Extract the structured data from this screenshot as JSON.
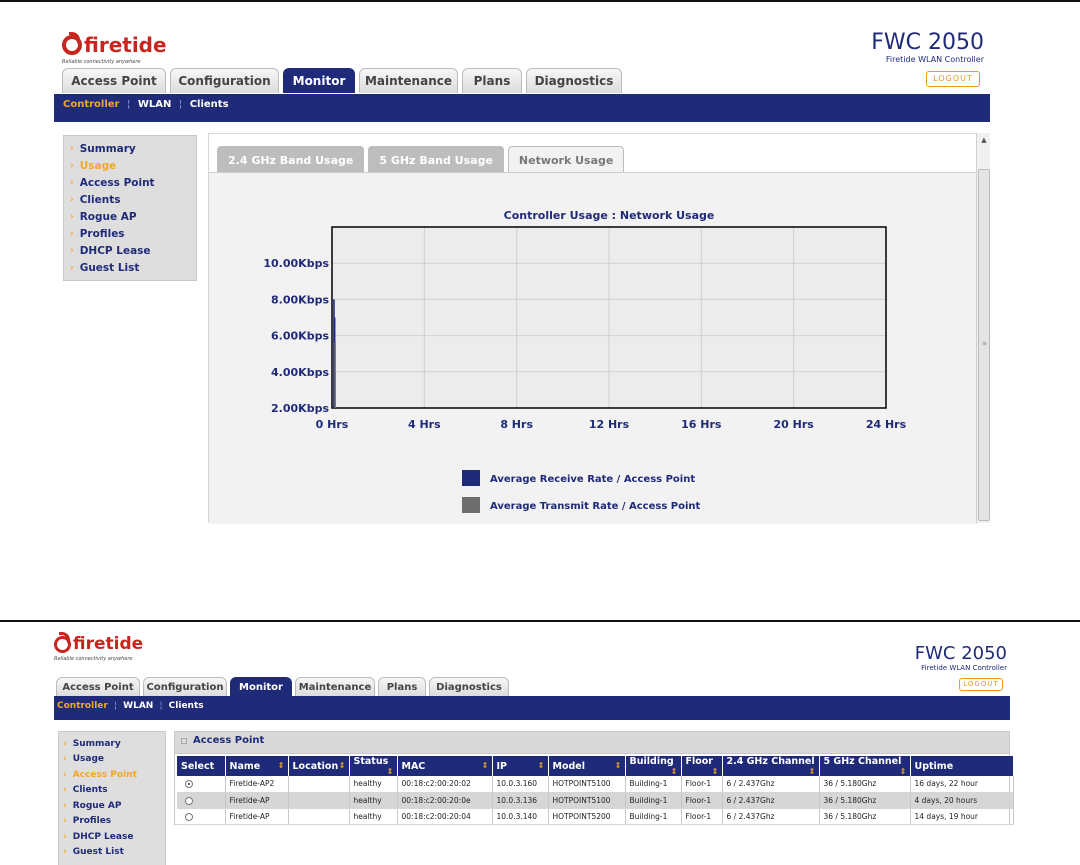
{
  "brand": {
    "logo_text": "firetide",
    "tagline": "Reliable connectivity anywhere",
    "product_name": "FWC 2050",
    "product_sub": "Firetide WLAN Controller",
    "logout_label": "LOGOUT"
  },
  "main_tabs": [
    "Access Point",
    "Configuration",
    "Monitor",
    "Maintenance",
    "Plans",
    "Diagnostics"
  ],
  "active_main_tab": "Monitor",
  "subnav": {
    "controller": "Controller",
    "wlan": "WLAN",
    "clients": "Clients",
    "sep": "¦"
  },
  "sidebar": {
    "items": [
      "Summary",
      "Usage",
      "Access Point",
      "Clients",
      "Rogue AP",
      "Profiles",
      "DHCP Lease",
      "Guest List"
    ]
  },
  "panel1": {
    "active_side": "Usage",
    "usage_tabs": [
      "2.4 GHz Band Usage",
      "5 GHz Band Usage",
      "Network Usage"
    ],
    "active_usage_tab": "Network Usage"
  },
  "chart_data": {
    "type": "bar",
    "title": "Controller Usage : Network Usage",
    "x_tick_labels": [
      "0 Hrs",
      "4 Hrs",
      "8 Hrs",
      "12 Hrs",
      "16 Hrs",
      "20 Hrs",
      "24 Hrs"
    ],
    "y_tick_labels": [
      "2.00Kbps",
      "4.00Kbps",
      "6.00Kbps",
      "8.00Kbps",
      "10.00Kbps"
    ],
    "x_range": [
      0,
      24
    ],
    "y_range": [
      2,
      12
    ],
    "grid": true,
    "legend_position": "bottom",
    "series": [
      {
        "name": "Average Receive Rate / Access Point",
        "color": "#1f2b78",
        "x": [
          0.05,
          0.08
        ],
        "values": [
          8.0,
          7.0
        ]
      },
      {
        "name": "Average Transmit Rate / Access Point",
        "color": "#6e6e6e",
        "x": [
          0.1
        ],
        "values": [
          5.6
        ]
      }
    ]
  },
  "panel2": {
    "active_side": "Access Point",
    "section_title": "Access Point",
    "columns": [
      "Select",
      "Name",
      "Location",
      "Status",
      "MAC",
      "IP",
      "Model",
      "Building",
      "Floor",
      "2.4 GHz Channel",
      "5 GHz Channel",
      "Uptime"
    ],
    "rows": [
      {
        "selected": true,
        "name": "Firetide-AP2",
        "location": "",
        "status": "healthy",
        "mac": "00:18:c2:00:20:02",
        "ip": "10.0.3.160",
        "model": "HOTPOINT5100",
        "building": "Building-1",
        "floor": "Floor-1",
        "ch24": "6 / 2.437Ghz",
        "ch5": "36 / 5.180Ghz",
        "uptime": "16 days, 22 hour"
      },
      {
        "selected": false,
        "name": "Firetide-AP",
        "location": "",
        "status": "healthy",
        "mac": "00:18:c2:00:20:0e",
        "ip": "10.0.3.136",
        "model": "HOTPOINT5100",
        "building": "Building-1",
        "floor": "Floor-1",
        "ch24": "6 / 2.437Ghz",
        "ch5": "36 / 5.180Ghz",
        "uptime": "4 days, 20 hours"
      },
      {
        "selected": false,
        "name": "Firetide-AP",
        "location": "",
        "status": "healthy",
        "mac": "00:18:c2:00:20:04",
        "ip": "10.0.3.140",
        "model": "HOTPOINT5200",
        "building": "Building-1",
        "floor": "Floor-1",
        "ch24": "6 / 2.437Ghz",
        "ch5": "36 / 5.180Ghz",
        "uptime": "14 days, 19 hour"
      }
    ]
  }
}
